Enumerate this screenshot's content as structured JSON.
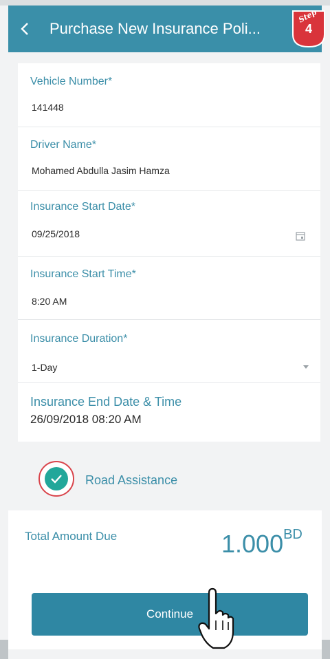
{
  "appbar": {
    "title": "Purchase New Insurance Poli...",
    "back_icon": "chevron-left-icon",
    "step_label": "Step",
    "step_number": "4"
  },
  "form": {
    "vehicle_number": {
      "label": "Vehicle Number*",
      "value": "141448"
    },
    "driver_name": {
      "label": "Driver Name*",
      "value": "Mohamed Abdulla Jasim Hamza"
    },
    "start_date": {
      "label": "Insurance Start Date*",
      "value": "09/25/2018",
      "icon": "calendar-icon"
    },
    "start_time": {
      "label": "Insurance Start Time*",
      "value": "8:20 AM"
    },
    "duration": {
      "label": "Insurance Duration*",
      "value": "1-Day",
      "icon": "dropdown-arrow-icon"
    },
    "end_datetime": {
      "label": "Insurance End Date & Time",
      "value": "26/09/2018 08:20 AM"
    }
  },
  "road_assistance": {
    "label": "Road Assistance",
    "checked": true
  },
  "total": {
    "label": "Total Amount Due",
    "amount": "1.000",
    "currency": "BD"
  },
  "actions": {
    "continue_label": "Continue"
  },
  "colors": {
    "primary": "#3a8fa9",
    "button": "#2f87a3",
    "check": "#22a79a",
    "highlight_ring": "#d9444b",
    "step_badge": "#d9343b"
  }
}
